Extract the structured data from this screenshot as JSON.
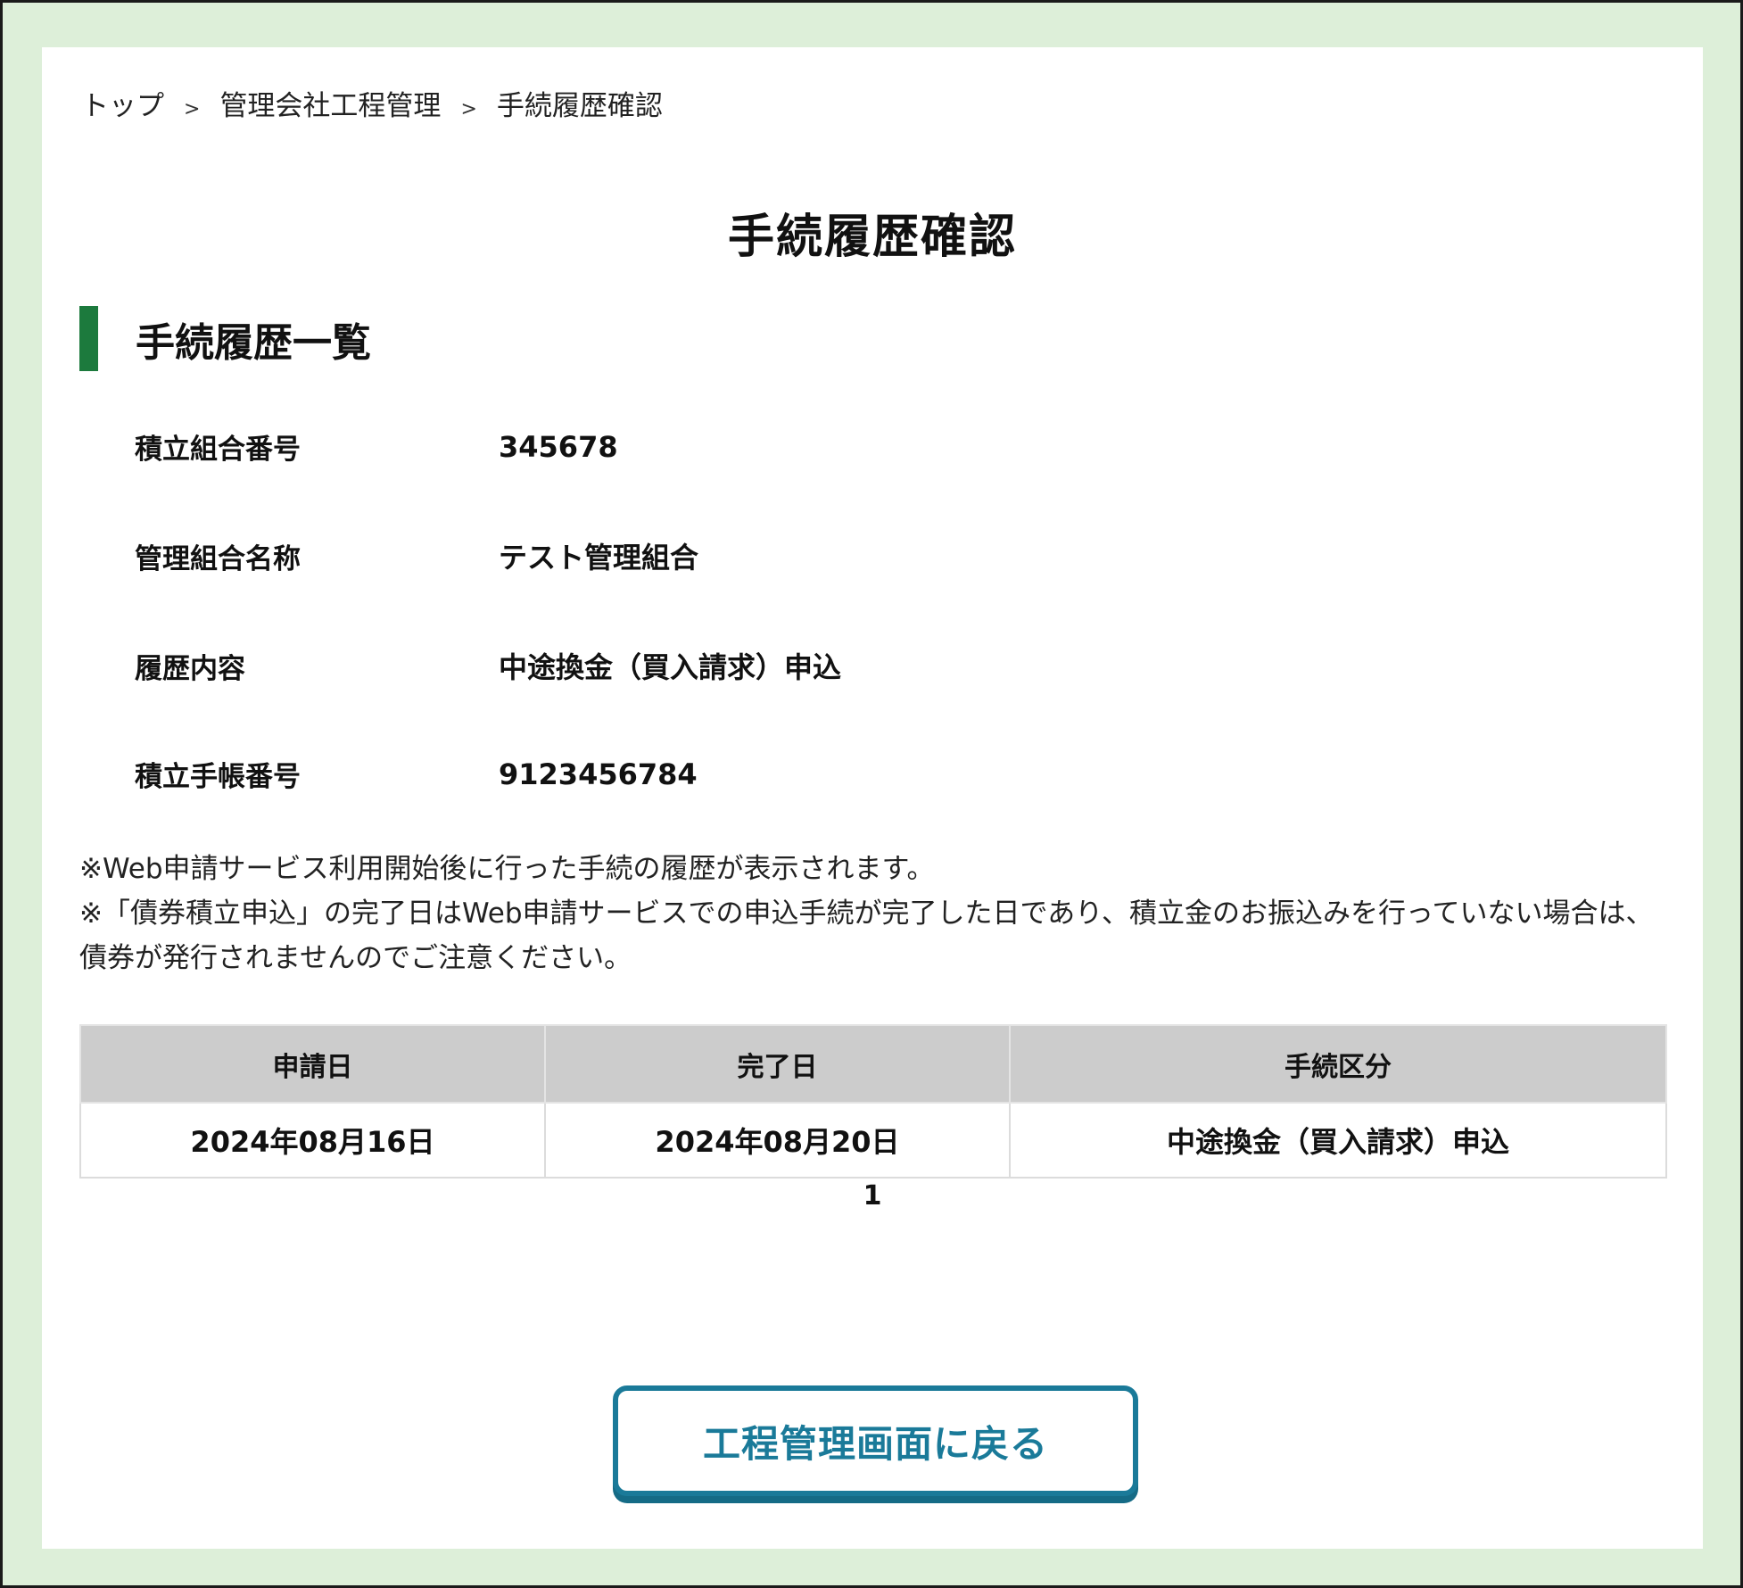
{
  "breadcrumb": {
    "items": [
      "トップ",
      "管理会社工程管理",
      "手続履歴確認"
    ],
    "separator": ">"
  },
  "page_title": "手続履歴確認",
  "section": {
    "title": "手続履歴一覧"
  },
  "info": [
    {
      "label": "積立組合番号",
      "value": "345678"
    },
    {
      "label": "管理組合名称",
      "value": "テスト管理組合"
    },
    {
      "label": "履歴内容",
      "value": "中途換金（買入請求）申込"
    },
    {
      "label": "積立手帳番号",
      "value": "9123456784"
    }
  ],
  "notes": [
    "※Web申請サービス利用開始後に行った手続の履歴が表示されます。",
    "※「債券積立申込」の完了日はWeb申請サービスでの申込手続が完了した日であり、積立金のお振込みを行っていない場合は、債券が発行されませんのでご注意ください。"
  ],
  "table": {
    "headers": [
      "申請日",
      "完了日",
      "手続区分"
    ],
    "rows": [
      [
        "2024年08月16日",
        "2024年08月20日",
        "中途換金（買入請求）申込"
      ]
    ]
  },
  "pager": {
    "current_page": "1"
  },
  "back_button": {
    "label": "工程管理画面に戻る"
  },
  "colors": {
    "frame_bg": "#ddefd9",
    "section_accent": "#1c7a3d",
    "button_accent": "#1a7a99",
    "table_header_bg": "#cccccc"
  }
}
